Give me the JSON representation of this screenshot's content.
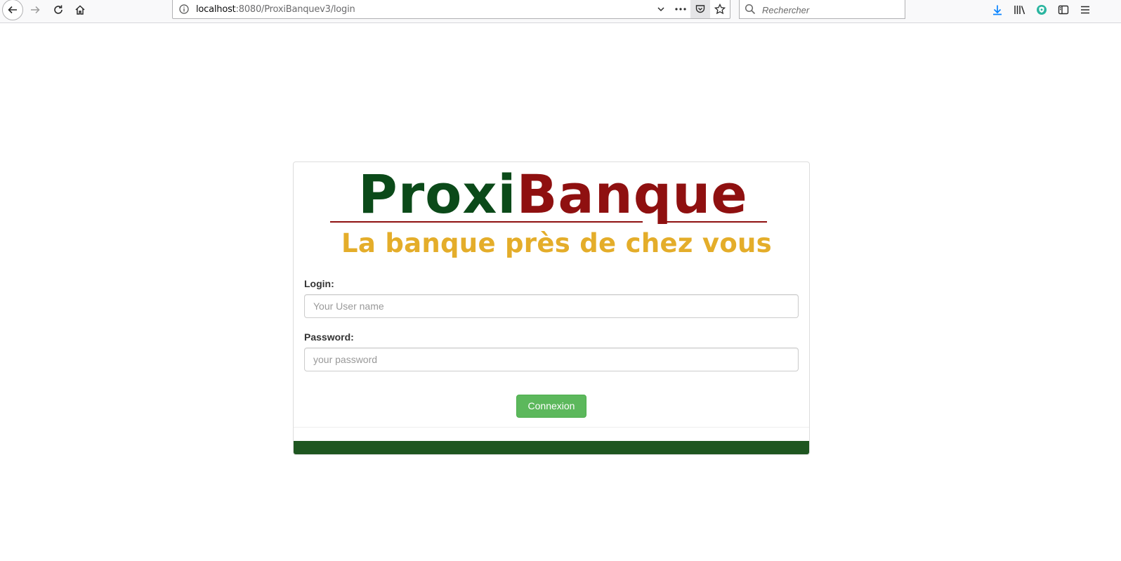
{
  "browser": {
    "url_host": "localhost",
    "url_path": ":8080/ProxiBanquev3/login",
    "search_placeholder": "Rechercher",
    "icons": {
      "back": "back-arrow-icon",
      "forward": "forward-arrow-icon",
      "reload": "reload-icon",
      "home": "home-icon",
      "info": "info-icon",
      "dropdown": "chevron-down-icon",
      "more": "more-dots-icon",
      "pocket": "pocket-icon",
      "bookmark": "star-icon",
      "search": "search-icon",
      "download": "download-icon",
      "library": "library-icon",
      "extension": "shield-extension-icon",
      "sidebar": "sidebar-icon",
      "menu": "hamburger-menu-icon"
    }
  },
  "logo": {
    "brand_part1": "Proxi",
    "brand_part2": "Banque",
    "tagline": "La banque près de chez vous",
    "colors": {
      "proxi": "#0b4a19",
      "banque": "#8f1010",
      "tagline": "#e4ad2a"
    }
  },
  "form": {
    "login_label": "Login:",
    "login_placeholder": "Your User name",
    "password_label": "Password:",
    "password_placeholder": "your password",
    "submit_label": "Connexion"
  },
  "colors": {
    "submit_bg": "#5cb85c",
    "footer_bar": "#1e5620"
  }
}
